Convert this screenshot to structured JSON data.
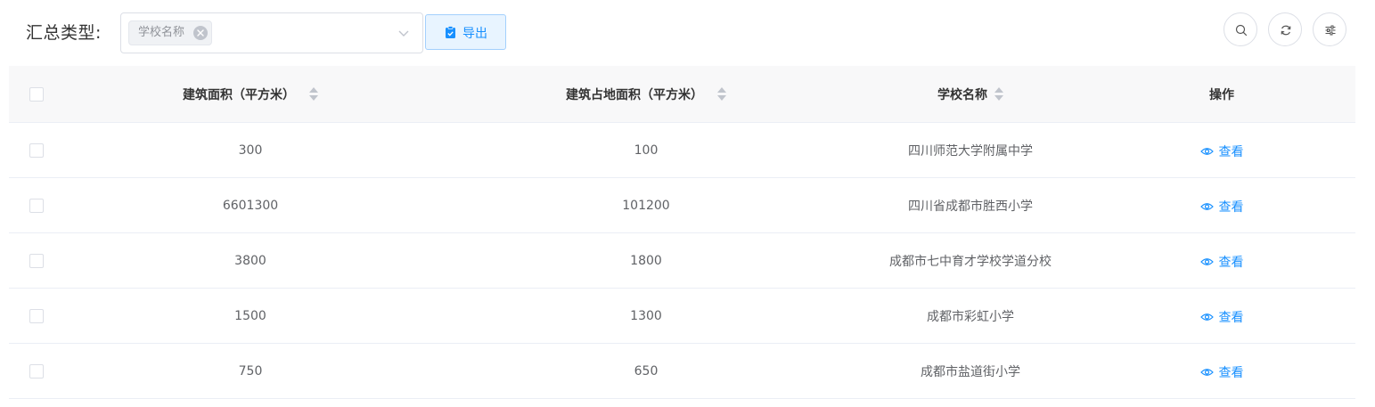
{
  "filter": {
    "label": "汇总类型:",
    "selected_tag": "学校名称"
  },
  "toolbar": {
    "export_label": "导出"
  },
  "colors": {
    "primary": "#1890ff",
    "export_bg": "#e8f4ff",
    "header_bg": "#f8f8f9"
  },
  "table": {
    "columns": [
      "建筑面积（平方米）",
      "建筑占地面积（平方米）",
      "学校名称",
      "操作"
    ],
    "action_label": "查看",
    "rows": [
      {
        "area": "300",
        "land": "100",
        "name": "四川师范大学附属中学"
      },
      {
        "area": "6601300",
        "land": "101200",
        "name": "四川省成都市胜西小学"
      },
      {
        "area": "3800",
        "land": "1800",
        "name": "成都市七中育才学校学道分校"
      },
      {
        "area": "1500",
        "land": "1300",
        "name": "成都市彩虹小学"
      },
      {
        "area": "750",
        "land": "650",
        "name": "成都市盐道街小学"
      }
    ]
  }
}
